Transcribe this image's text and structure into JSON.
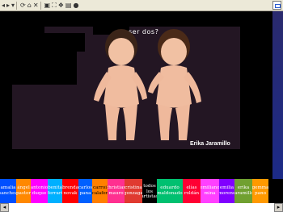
{
  "toolbar": {
    "items": [
      {
        "name": "back-button",
        "glyph": "◂"
      },
      {
        "name": "forward-button",
        "glyph": "▸"
      },
      {
        "name": "dropdown-button",
        "glyph": "▾"
      },
      {
        "name": "refresh-icon",
        "glyph": "⟳"
      },
      {
        "name": "home-icon",
        "glyph": "⌂"
      },
      {
        "name": "stop-icon",
        "glyph": "✕"
      },
      {
        "name": "image-icon",
        "glyph": "▣"
      },
      {
        "name": "fullscreen-icon",
        "glyph": "⛶"
      },
      {
        "name": "bookmark-icon",
        "glyph": "❖"
      },
      {
        "name": "print-icon",
        "glyph": "▤"
      },
      {
        "name": "record-icon",
        "glyph": "●"
      }
    ]
  },
  "stage": {
    "caption": "ser dos?",
    "signature": "Erika Jaramillo"
  },
  "nav": [
    {
      "label": "amalia sanchez",
      "bg": "#0050ff",
      "fg": "#ffffff"
    },
    {
      "label": "ángel pastor",
      "bg": "#ff8800",
      "fg": "#ffffff"
    },
    {
      "label": "antonio duque",
      "bg": "#ff00ff",
      "fg": "#ffffff"
    },
    {
      "label": "benita ferrari",
      "bg": "#00b0ff",
      "fg": "#ffffff"
    },
    {
      "label": "brenda novak",
      "bg": "#ff0000",
      "fg": "#ffffff"
    },
    {
      "label": "carlos pana",
      "bg": "#0060ff",
      "fg": "#ffffff"
    },
    {
      "label": "carroi calafer",
      "bg": "#ff8000",
      "fg": "#000000"
    },
    {
      "label": "christian mauro",
      "bg": "#ff3090",
      "fg": "#ffffff"
    },
    {
      "label": "cristina gonzaga",
      "bg": "#e03a30",
      "fg": "#ffffff"
    },
    {
      "label": "todos los artistas",
      "bg": "#000000",
      "fg": "#ffffff"
    },
    {
      "label": "eduardo maldonado",
      "bg": "#00c070",
      "fg": "#ffffff"
    },
    {
      "label": "elías roldán",
      "bg": "#ff0033",
      "fg": "#ffffff"
    },
    {
      "label": "emiliano mina",
      "bg": "#ff40ff",
      "fg": "#ffffff"
    },
    {
      "label": "emilia moreno",
      "bg": "#8000ff",
      "fg": "#ffffff"
    },
    {
      "label": "erika jaramillo",
      "bg": "#70a030",
      "fg": "#ffffff"
    },
    {
      "label": "gemma pano",
      "bg": "#ff9900",
      "fg": "#ffffff"
    }
  ],
  "scroll": {
    "left": "◂",
    "right": "▸"
  }
}
